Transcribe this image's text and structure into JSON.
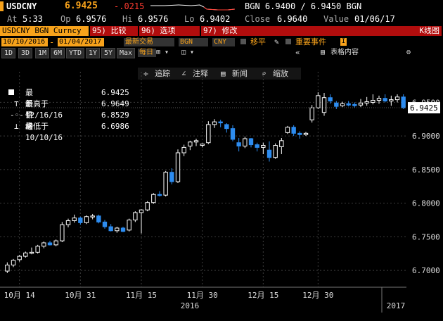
{
  "header": {
    "ticker": "USDCNY",
    "last": "6.9425",
    "change": "-.0215",
    "quote": "BGN  6.9400 / 6.9450  BGN",
    "at_label": "At",
    "at_value": "5:33",
    "op_label": "Op",
    "op_value": "6.9576",
    "hi_label": "Hi",
    "hi_value": "6.9576",
    "lo_label": "Lo",
    "lo_value": "6.9402",
    "close_label": "Close",
    "close_value": "6.9640",
    "value_label": "Value",
    "value_date": "01/06/17"
  },
  "toolbar": {
    "security": "USDCNY BGN Curncy",
    "compare": "95) 比较",
    "options": "96) 选项",
    "modify": "97) 修改",
    "chart_type": "K线图",
    "start_date": "10/10/2016",
    "end_date": "01/04/2017",
    "last_trade": "最新交易",
    "source": "BGN",
    "currency": "CNY",
    "move_avg": "移平",
    "events": "重要事件"
  },
  "periods": [
    "1D",
    "3D",
    "1M",
    "6M",
    "YTD",
    "1Y",
    "5Y",
    "Max"
  ],
  "period_dropdown": "每日",
  "tools": {
    "track": "追踪",
    "annotate": "注释",
    "news": "新闻",
    "zoom": "缩放",
    "table": "表格内容"
  },
  "legend": {
    "last_label": "最新价格",
    "last_value": "6.9425",
    "high_label": "最高于 12/16/16",
    "high_value": "6.9649",
    "avg_label": "平均",
    "avg_value": "6.8529",
    "low_label": "最低于 10/10/16",
    "low_value": "6.6986"
  },
  "chart_data": {
    "type": "candlestick",
    "title": "",
    "y_ticks": [
      6.7,
      6.75,
      6.8,
      6.85,
      6.9,
      6.95
    ],
    "y_tick_labels": [
      "6.7000",
      "6.7500",
      "6.8000",
      "6.8500",
      "6.9000",
      "6.9500"
    ],
    "ylim": [
      6.675,
      6.985
    ],
    "x_tick_labels": [
      "10月 14",
      "10月 31",
      "11月 15",
      "11月 30",
      "12月 15",
      "12月 30"
    ],
    "x_year_labels": [
      "2016",
      "2017"
    ],
    "last_price_label": "6.9425",
    "colors": {
      "up": "#ffffff",
      "down": "#2d8cf0",
      "grid": "#3c3c3c"
    },
    "candles": [
      {
        "o": 6.699,
        "h": 6.712,
        "l": 6.696,
        "c": 6.708
      },
      {
        "o": 6.708,
        "h": 6.717,
        "l": 6.705,
        "c": 6.715
      },
      {
        "o": 6.716,
        "h": 6.723,
        "l": 6.713,
        "c": 6.721
      },
      {
        "o": 6.721,
        "h": 6.728,
        "l": 6.719,
        "c": 6.726
      },
      {
        "o": 6.726,
        "h": 6.734,
        "l": 6.724,
        "c": 6.727
      },
      {
        "o": 6.727,
        "h": 6.738,
        "l": 6.725,
        "c": 6.736
      },
      {
        "o": 6.736,
        "h": 6.743,
        "l": 6.733,
        "c": 6.741
      },
      {
        "o": 6.741,
        "h": 6.744,
        "l": 6.737,
        "c": 6.738
      },
      {
        "o": 6.738,
        "h": 6.746,
        "l": 6.736,
        "c": 6.744
      },
      {
        "o": 6.744,
        "h": 6.772,
        "l": 6.742,
        "c": 6.768
      },
      {
        "o": 6.768,
        "h": 6.777,
        "l": 6.764,
        "c": 6.774
      },
      {
        "o": 6.774,
        "h": 6.783,
        "l": 6.771,
        "c": 6.778
      },
      {
        "o": 6.778,
        "h": 6.78,
        "l": 6.768,
        "c": 6.771
      },
      {
        "o": 6.771,
        "h": 6.782,
        "l": 6.769,
        "c": 6.78
      },
      {
        "o": 6.78,
        "h": 6.784,
        "l": 6.776,
        "c": 6.781
      },
      {
        "o": 6.781,
        "h": 6.783,
        "l": 6.77,
        "c": 6.772
      },
      {
        "o": 6.772,
        "h": 6.775,
        "l": 6.762,
        "c": 6.765
      },
      {
        "o": 6.765,
        "h": 6.769,
        "l": 6.758,
        "c": 6.759
      },
      {
        "o": 6.759,
        "h": 6.765,
        "l": 6.756,
        "c": 6.763
      },
      {
        "o": 6.763,
        "h": 6.765,
        "l": 6.757,
        "c": 6.758
      },
      {
        "o": 6.76,
        "h": 6.777,
        "l": 6.758,
        "c": 6.775
      },
      {
        "o": 6.775,
        "h": 6.788,
        "l": 6.772,
        "c": 6.786
      },
      {
        "o": 6.786,
        "h": 6.791,
        "l": 6.755,
        "c": 6.79
      },
      {
        "o": 6.79,
        "h": 6.803,
        "l": 6.788,
        "c": 6.801
      },
      {
        "o": 6.801,
        "h": 6.815,
        "l": 6.799,
        "c": 6.813
      },
      {
        "o": 6.813,
        "h": 6.818,
        "l": 6.81,
        "c": 6.812
      },
      {
        "o": 6.812,
        "h": 6.848,
        "l": 6.81,
        "c": 6.846
      },
      {
        "o": 6.846,
        "h": 6.852,
        "l": 6.828,
        "c": 6.832
      },
      {
        "o": 6.832,
        "h": 6.88,
        "l": 6.83,
        "c": 6.875
      },
      {
        "o": 6.875,
        "h": 6.887,
        "l": 6.87,
        "c": 6.883
      },
      {
        "o": 6.885,
        "h": 6.893,
        "l": 6.879,
        "c": 6.891
      },
      {
        "o": 6.891,
        "h": 6.896,
        "l": 6.885,
        "c": 6.893
      },
      {
        "o": 6.886,
        "h": 6.889,
        "l": 6.883,
        "c": 6.888
      },
      {
        "o": 6.89,
        "h": 6.922,
        "l": 6.888,
        "c": 6.917
      },
      {
        "o": 6.917,
        "h": 6.925,
        "l": 6.912,
        "c": 6.921
      },
      {
        "o": 6.921,
        "h": 6.924,
        "l": 6.913,
        "c": 6.92
      },
      {
        "o": 6.917,
        "h": 6.919,
        "l": 6.905,
        "c": 6.911
      },
      {
        "o": 6.911,
        "h": 6.916,
        "l": 6.892,
        "c": 6.895
      },
      {
        "o": 6.89,
        "h": 6.897,
        "l": 6.877,
        "c": 6.885
      },
      {
        "o": 6.885,
        "h": 6.899,
        "l": 6.882,
        "c": 6.896
      },
      {
        "o": 6.896,
        "h": 6.897,
        "l": 6.883,
        "c": 6.887
      },
      {
        "o": 6.887,
        "h": 6.89,
        "l": 6.877,
        "c": 6.883
      },
      {
        "o": 6.883,
        "h": 6.89,
        "l": 6.873,
        "c": 6.886
      },
      {
        "o": 6.879,
        "h": 6.892,
        "l": 6.862,
        "c": 6.868
      },
      {
        "o": 6.868,
        "h": 6.889,
        "l": 6.866,
        "c": 6.886
      },
      {
        "o": 6.884,
        "h": 6.897,
        "l": 6.873,
        "c": 6.893
      },
      {
        "o": 6.905,
        "h": 6.915,
        "l": 6.903,
        "c": 6.913
      },
      {
        "o": 6.913,
        "h": 6.916,
        "l": 6.9,
        "c": 6.904
      },
      {
        "o": 6.904,
        "h": 6.907,
        "l": 6.896,
        "c": 6.902
      },
      {
        "o": 6.902,
        "h": 6.906,
        "l": 6.9,
        "c": 6.904
      },
      {
        "o": 6.924,
        "h": 6.946,
        "l": 6.92,
        "c": 6.942
      },
      {
        "o": 6.942,
        "h": 6.965,
        "l": 6.94,
        "c": 6.96
      },
      {
        "o": 6.935,
        "h": 6.964,
        "l": 6.93,
        "c": 6.957
      },
      {
        "o": 6.957,
        "h": 6.962,
        "l": 6.948,
        "c": 6.952
      },
      {
        "o": 6.949,
        "h": 6.952,
        "l": 6.94,
        "c": 6.944
      },
      {
        "o": 6.945,
        "h": 6.951,
        "l": 6.943,
        "c": 6.948
      },
      {
        "o": 6.948,
        "h": 6.952,
        "l": 6.944,
        "c": 6.946
      },
      {
        "o": 6.947,
        "h": 6.95,
        "l": 6.942,
        "c": 6.945
      },
      {
        "o": 6.946,
        "h": 6.955,
        "l": 6.943,
        "c": 6.949
      },
      {
        "o": 6.949,
        "h": 6.958,
        "l": 6.945,
        "c": 6.951
      },
      {
        "o": 6.95,
        "h": 6.962,
        "l": 6.947,
        "c": 6.953
      },
      {
        "o": 6.953,
        "h": 6.96,
        "l": 6.948,
        "c": 6.956
      },
      {
        "o": 6.956,
        "h": 6.962,
        "l": 6.95,
        "c": 6.952
      },
      {
        "o": 6.952,
        "h": 6.96,
        "l": 6.945,
        "c": 6.954
      },
      {
        "o": 6.954,
        "h": 6.962,
        "l": 6.95,
        "c": 6.958
      },
      {
        "o": 6.958,
        "h": 6.962,
        "l": 6.94,
        "c": 6.942
      }
    ]
  }
}
